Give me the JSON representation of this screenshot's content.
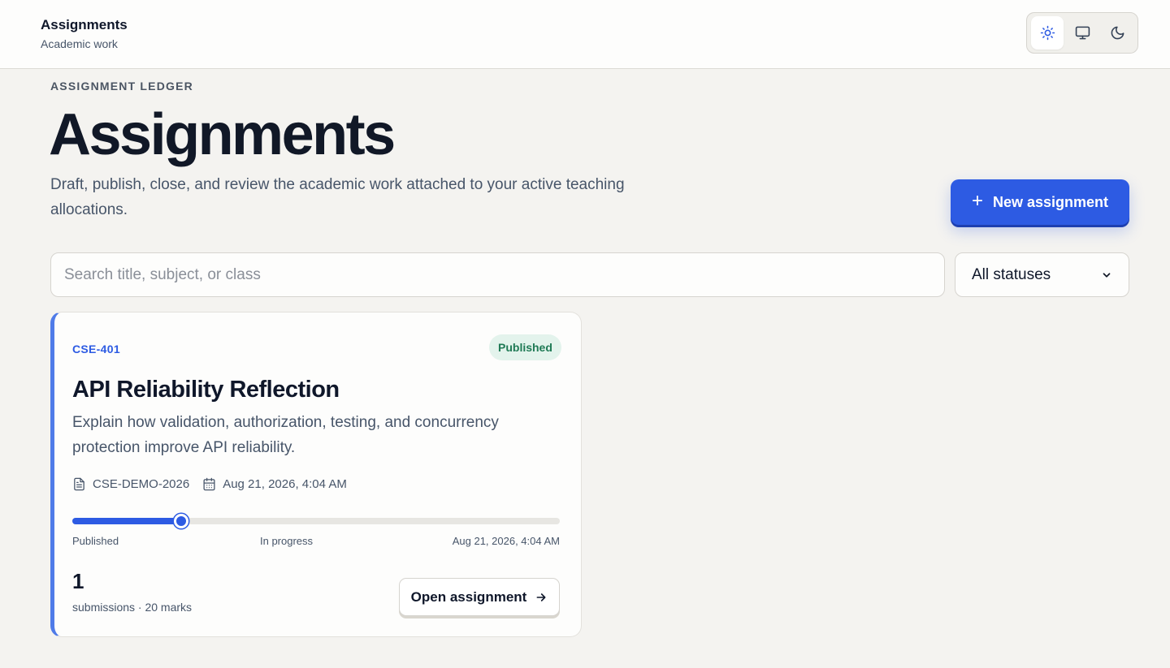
{
  "header": {
    "title": "Assignments",
    "subtitle": "Academic work",
    "theme_options": [
      "light",
      "system",
      "dark"
    ],
    "theme_selected": "light"
  },
  "page": {
    "eyebrow": "ASSIGNMENT LEDGER",
    "title": "Assignments",
    "description": "Draft, publish, close, and review the academic work attached to your active teaching allocations.",
    "new_button_label": "New assignment"
  },
  "filters": {
    "search_placeholder": "Search title, subject, or class",
    "search_value": "",
    "status_selected": "All statuses"
  },
  "assignments": [
    {
      "code": "CSE-401",
      "status": "Published",
      "title": "API Reliability Reflection",
      "description": "Explain how validation, authorization, testing, and concurrency protection improve API reliability.",
      "class_code": "CSE-DEMO-2026",
      "due": "Aug 21, 2026, 4:04 AM",
      "progress_fraction": 0.223,
      "progress_labels": {
        "start": "Published",
        "middle": "In progress",
        "end": "Aug 21, 2026, 4:04 AM"
      },
      "submission_count": "1",
      "summary": "submissions · 20 marks",
      "open_button_label": "Open assignment"
    }
  ],
  "colors": {
    "accent": "#2d5be3",
    "published_badge_bg": "#e3f3ec",
    "published_badge_text": "#1f7a55",
    "background": "#f4f3f0"
  },
  "icons": {
    "theme_light": "sun-icon",
    "theme_system": "monitor-icon",
    "theme_dark": "moon-icon",
    "class": "document-icon",
    "due": "calendar-icon",
    "open": "arrow-right-icon",
    "new": "plus-icon",
    "select": "chevron-down-icon"
  }
}
